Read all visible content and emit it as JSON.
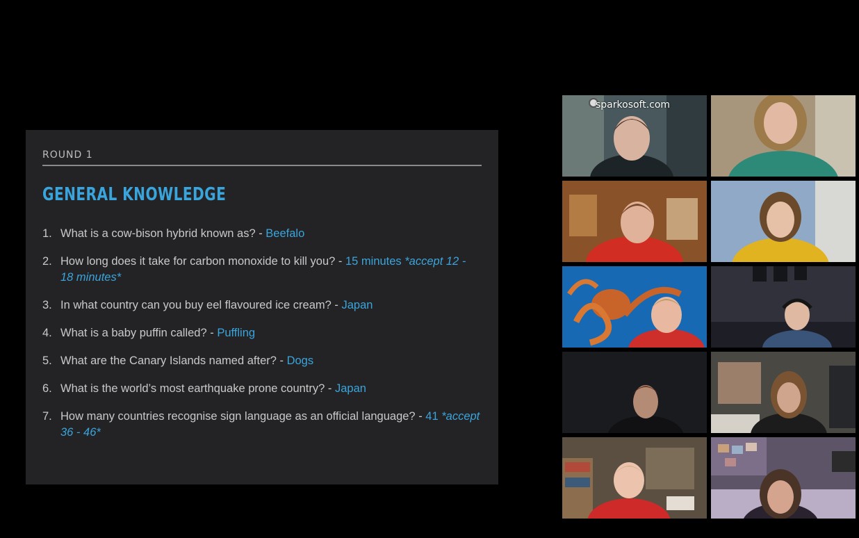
{
  "slide": {
    "round_label": "ROUND 1",
    "title": "GENERAL KNOWLEDGE",
    "questions": [
      {
        "num": "1.",
        "text": "What is a cow-bison hybrid known as? - ",
        "answer": "Beefalo",
        "note": ""
      },
      {
        "num": "2.",
        "text": "How long does it take for carbon monoxide to kill you? - ",
        "answer": "15 minutes ",
        "note": "*accept 12 - 18 minutes*"
      },
      {
        "num": "3.",
        "text": "In what country can you buy eel flavoured ice cream? - ",
        "answer": "Japan",
        "note": ""
      },
      {
        "num": "4.",
        "text": "What is a baby puffin called? - ",
        "answer": "Puffling",
        "note": ""
      },
      {
        "num": "5.",
        "text": "What are the Canary Islands named after? - ",
        "answer": "Dogs",
        "note": ""
      },
      {
        "num": "6.",
        "text": "What is the world’s most earthquake prone country? - ",
        "answer": "Japan",
        "note": ""
      },
      {
        "num": "7.",
        "text": "How many countries recognise sign language as an official language? - ",
        "answer": "41 ",
        "note": "*accept 36 - 46*"
      }
    ]
  },
  "video_grid": {
    "watermark": "sparkosoft.com",
    "tiles": [
      {
        "id": "tile-1",
        "bg": "#3d4c52"
      },
      {
        "id": "tile-2",
        "bg": "#8f7f6a"
      },
      {
        "id": "tile-3",
        "bg": "#7a4d2a"
      },
      {
        "id": "tile-4",
        "bg": "#8ba4c2"
      },
      {
        "id": "tile-5",
        "bg": "#1c5f9e"
      },
      {
        "id": "tile-6",
        "bg": "#2c2d33"
      },
      {
        "id": "tile-7",
        "bg": "#1a1b1e"
      },
      {
        "id": "tile-8",
        "bg": "#3b3a36"
      },
      {
        "id": "tile-9",
        "bg": "#4f4639"
      },
      {
        "id": "tile-10",
        "bg": "#51495a"
      }
    ]
  },
  "colors": {
    "accent": "#3aa5dc",
    "slide_bg": "#232325",
    "page_bg": "#000000"
  }
}
